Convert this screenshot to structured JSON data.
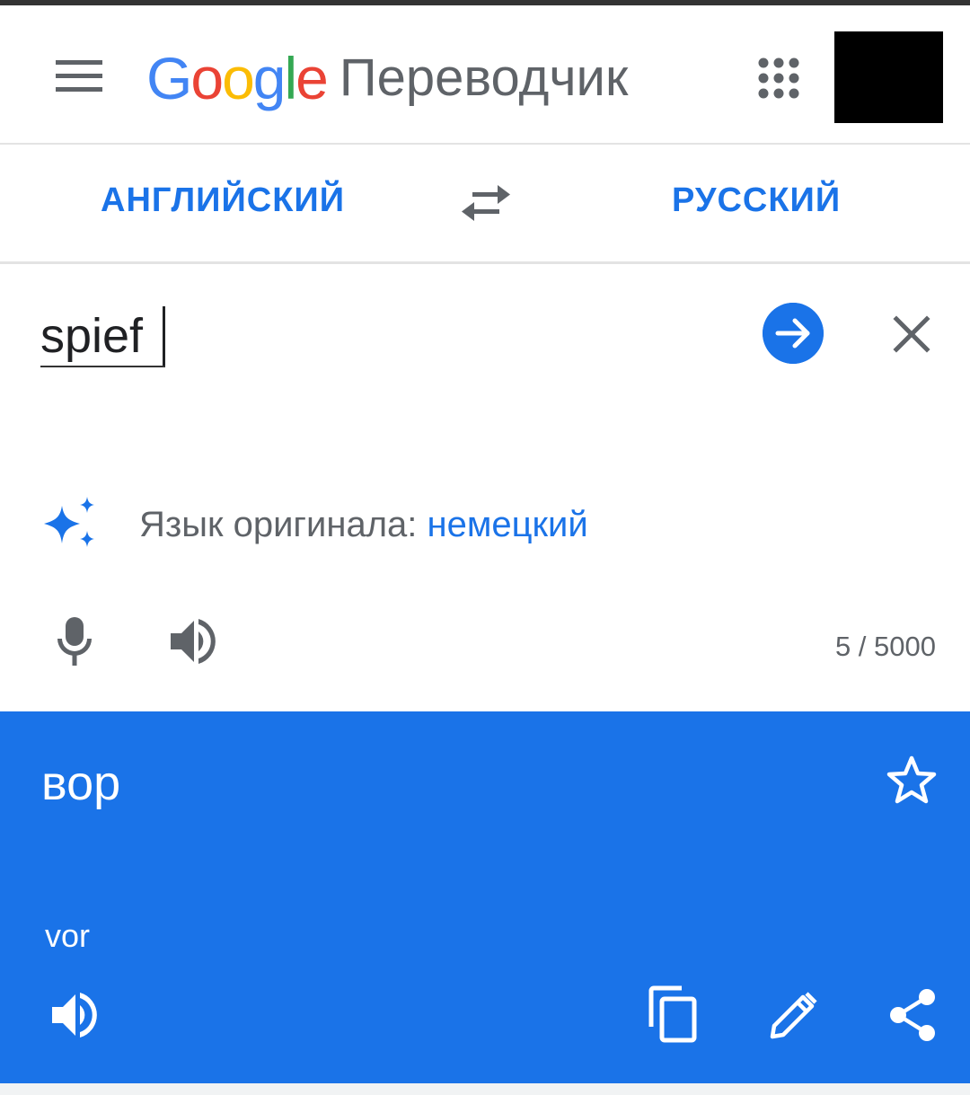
{
  "header": {
    "logo_letters": [
      "G",
      "o",
      "o",
      "g",
      "l",
      "e"
    ],
    "logo_colors": [
      "#4285F4",
      "#EA4335",
      "#FBBC05",
      "#4285F4",
      "#34A853",
      "#EA4335"
    ],
    "product_name": "Переводчик"
  },
  "icons": {
    "menu": "menu-icon",
    "apps": "apps-grid-icon",
    "swap": "swap-arrows-icon",
    "go": "arrow-right-icon",
    "clear": "close-icon",
    "detect": "sparkle-icon",
    "mic": "microphone-icon",
    "speaker": "speaker-icon",
    "star": "star-outline-icon",
    "copy": "copy-icon",
    "edit": "pencil-icon",
    "share": "share-icon"
  },
  "languages": {
    "source": "АНГЛИЙСКИЙ",
    "target": "РУССКИЙ"
  },
  "input": {
    "text": "spief",
    "char_count": "5 / 5000"
  },
  "detect": {
    "label": "Язык оригинала: ",
    "language": "немецкий"
  },
  "output": {
    "text": "вор",
    "transliteration": "vor"
  },
  "colors": {
    "accent": "#1a73e8",
    "icon_gray": "#5f6368",
    "text": "#202124"
  }
}
